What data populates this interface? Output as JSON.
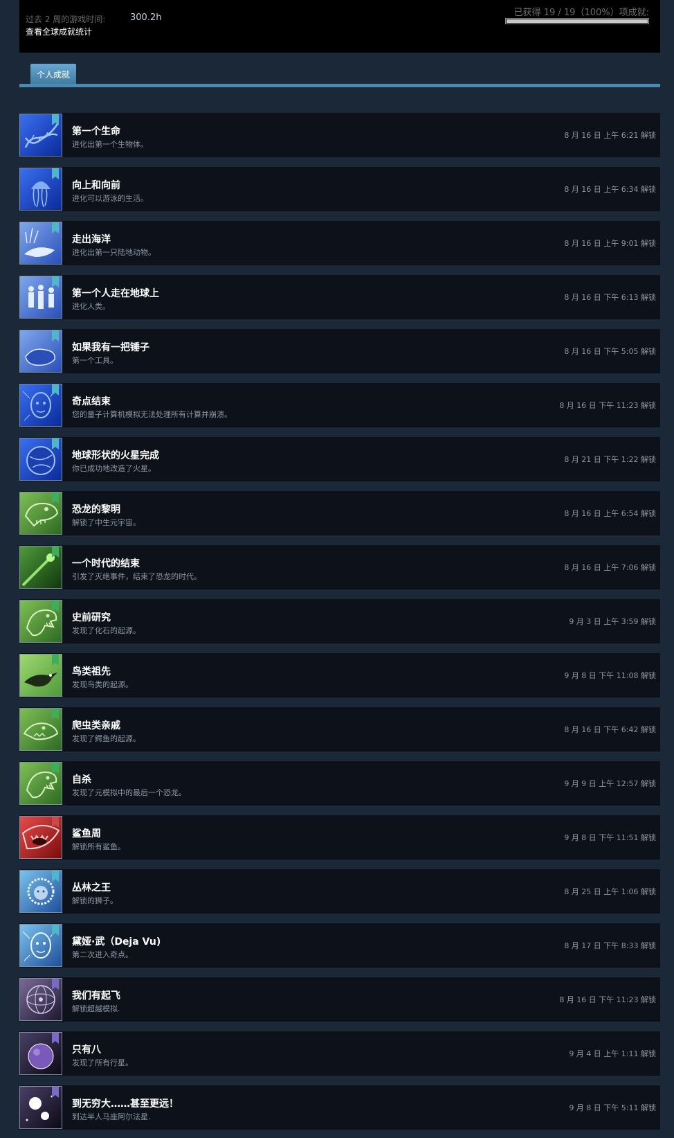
{
  "header": {
    "playtime_label": "过去 2 周的游戏时间:",
    "playtime_value": "300.2h",
    "global_stats_link": "查看全球成就统计",
    "progress_text": "已获得 19 / 19（100%）项成就:",
    "progress_fraction": 1.0
  },
  "tabs": {
    "personal": "个人成就"
  },
  "achievements": [
    {
      "title": "第一个生命",
      "desc": "进化出第一个生物体。",
      "date": "8 月 16 日 上午 6:21 解锁",
      "icon": "dna-helix-icon",
      "theme": "blue"
    },
    {
      "title": "向上和向前",
      "desc": "进化可以游泳的生活。",
      "date": "8 月 16 日 上午 6:34 解锁",
      "icon": "jellyfish-icon",
      "theme": "blue"
    },
    {
      "title": "走出海洋",
      "desc": "进化出第一只陆地动物。",
      "date": "8 月 16 日 上午 9:01 解锁",
      "icon": "sea-creature-icon",
      "theme": "blue-light"
    },
    {
      "title": "第一个人走在地球上",
      "desc": "进化人类。",
      "date": "8 月 16 日 下午 6:13 解锁",
      "icon": "early-humans-icon",
      "theme": "blue-light"
    },
    {
      "title": "如果我有一把锤子",
      "desc": "第一个工具。",
      "date": "8 月 16 日 下午 5:05 解锁",
      "icon": "stone-tool-icon",
      "theme": "blue-light"
    },
    {
      "title": "奇点结束",
      "desc": "您的量子计算机模拟无法处理所有计算并崩溃。",
      "date": "8 月 16 日 下午 11:23 解锁",
      "icon": "digital-face-icon",
      "theme": "blue"
    },
    {
      "title": "地球形状的火星完成",
      "desc": "你已成功地改造了火星。",
      "date": "8 月 21 日 下午 1:22 解锁",
      "icon": "planet-globe-icon",
      "theme": "blue"
    },
    {
      "title": "恐龙的黎明",
      "desc": "解锁了中生元宇宙。",
      "date": "8 月 16 日 上午 6:54 解锁",
      "icon": "dinosaur-skull-icon",
      "theme": "green"
    },
    {
      "title": "一个时代的结束",
      "desc": "引发了灭绝事件，结束了恐龙的时代。",
      "date": "8 月 16 日 上午 7:06 解锁",
      "icon": "meteor-icon",
      "theme": "green-dark"
    },
    {
      "title": "史前研究",
      "desc": "发现了化石的起源。",
      "date": "9 月 3 日 上午 3:59 解锁",
      "icon": "raptor-icon",
      "theme": "green"
    },
    {
      "title": "鸟类祖先",
      "desc": "发现鸟类的起源。",
      "date": "9 月 8 日 下午 11:08 解锁",
      "icon": "bird-icon",
      "theme": "green-light"
    },
    {
      "title": "爬虫类亲戚",
      "desc": "发现了鳄鱼的起源。",
      "date": "8 月 16 日 下午 6:42 解锁",
      "icon": "crocodile-icon",
      "theme": "green"
    },
    {
      "title": "自杀",
      "desc": "发现了元模拟中的最后一个恐龙。",
      "date": "9 月 9 日 上午 12:57 解锁",
      "icon": "raptor-icon",
      "theme": "green"
    },
    {
      "title": "鲨鱼周",
      "desc": "解锁所有鲨鱼。",
      "date": "9 月 8 日 下午 11:51 解锁",
      "icon": "shark-icon",
      "theme": "red"
    },
    {
      "title": "丛林之王",
      "desc": "解锁的狮子。",
      "date": "8 月 25 日 上午 1:06 解锁",
      "icon": "lion-icon",
      "theme": "ice"
    },
    {
      "title": "黛娅·武（Deja Vu)",
      "desc": "第二次进入奇点。",
      "date": "8 月 17 日 下午 8:33 解锁",
      "icon": "digital-face-icon",
      "theme": "ice"
    },
    {
      "title": "我们有起飞",
      "desc": "解锁超越模拟.",
      "date": "8 月 16 日 下午 11:23 解锁",
      "icon": "space-sphere-icon",
      "theme": "purple"
    },
    {
      "title": "只有八",
      "desc": "发现了所有行星。",
      "date": "9 月 4 日 上午 1:11 解锁",
      "icon": "planet-icon",
      "theme": "purple-dark"
    },
    {
      "title": "到无穷大……甚至更远！",
      "desc": "到达半人马座阿尔法星.",
      "date": "9 月 8 日 下午 5:11 解锁",
      "icon": "binary-stars-icon",
      "theme": "purple-dark"
    }
  ]
}
